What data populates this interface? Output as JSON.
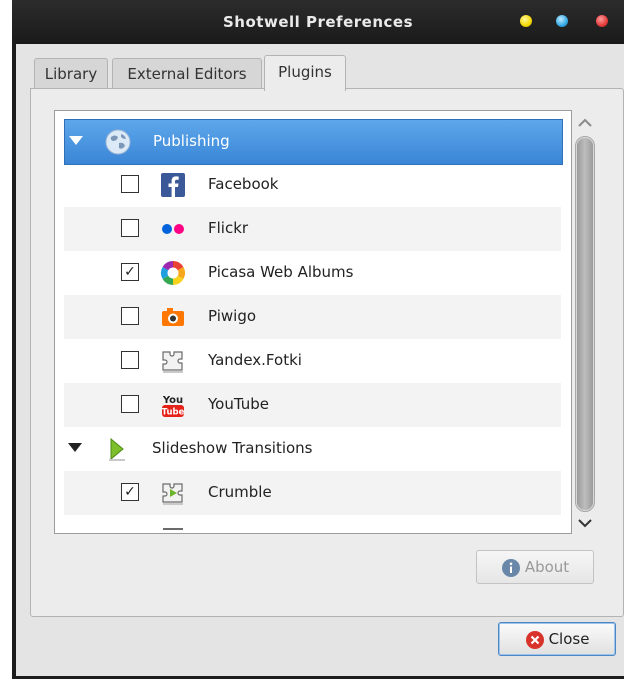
{
  "window": {
    "title": "Shotwell Preferences"
  },
  "tabs": [
    {
      "label": "Library"
    },
    {
      "label": "External Editors"
    },
    {
      "label": "Plugins"
    }
  ],
  "plugins": {
    "publishing": {
      "label": "Publishing",
      "items": [
        {
          "label": "Facebook",
          "checked": false,
          "icon": "facebook-icon"
        },
        {
          "label": "Flickr",
          "checked": false,
          "icon": "flickr-icon"
        },
        {
          "label": "Picasa Web Albums",
          "checked": true,
          "icon": "picasa-icon"
        },
        {
          "label": "Piwigo",
          "checked": false,
          "icon": "piwigo-camera-icon"
        },
        {
          "label": "Yandex.Fotki",
          "checked": false,
          "icon": "puzzle-plugin-icon"
        },
        {
          "label": "YouTube",
          "checked": false,
          "icon": "youtube-icon"
        }
      ]
    },
    "transitions": {
      "label": "Slideshow Transitions",
      "items": [
        {
          "label": "Crumble",
          "checked": true,
          "icon": "transition-plugin-icon"
        }
      ]
    }
  },
  "buttons": {
    "about": "About",
    "close": "Close"
  },
  "colors": {
    "selection": "#3a86d6",
    "close_icon": "#d9342b",
    "about_icon": "#6a86a8"
  }
}
